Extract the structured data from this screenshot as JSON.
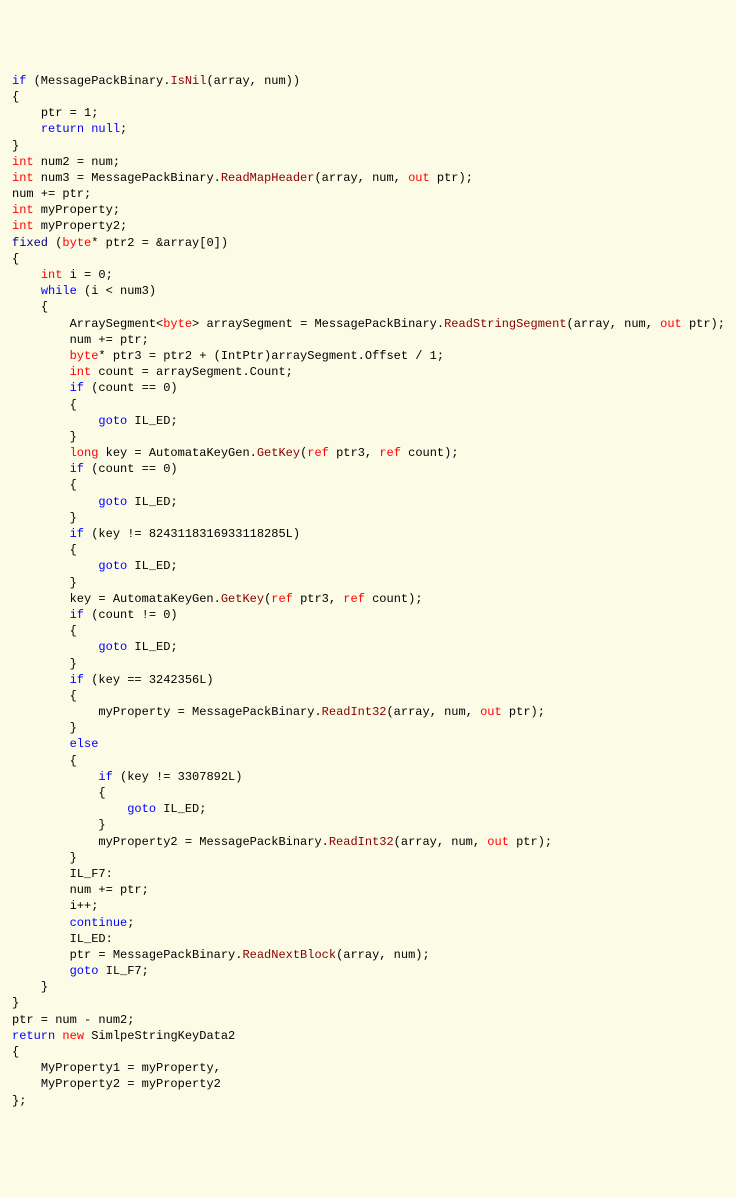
{
  "lines": [
    {
      "indent": 0,
      "tokens": [
        {
          "t": "if",
          "c": "kw"
        },
        {
          "t": " (MessagePackBinary."
        },
        {
          "t": "IsNil",
          "c": "method"
        },
        {
          "t": "(array, num))"
        }
      ]
    },
    {
      "indent": 0,
      "tokens": [
        {
          "t": "{"
        }
      ]
    },
    {
      "indent": 1,
      "tokens": [
        {
          "t": "ptr = 1;"
        }
      ]
    },
    {
      "indent": 1,
      "tokens": [
        {
          "t": "return",
          "c": "kw"
        },
        {
          "t": " "
        },
        {
          "t": "null",
          "c": "kw"
        },
        {
          "t": ";"
        }
      ]
    },
    {
      "indent": 0,
      "tokens": [
        {
          "t": "}"
        }
      ]
    },
    {
      "indent": 0,
      "tokens": [
        {
          "t": "int",
          "c": "type"
        },
        {
          "t": " num2 = num;"
        }
      ]
    },
    {
      "indent": 0,
      "tokens": [
        {
          "t": "int",
          "c": "type"
        },
        {
          "t": " num3 = MessagePackBinary."
        },
        {
          "t": "ReadMapHeader",
          "c": "method"
        },
        {
          "t": "(array, num, "
        },
        {
          "t": "out",
          "c": "type"
        },
        {
          "t": " ptr);"
        }
      ]
    },
    {
      "indent": 0,
      "tokens": [
        {
          "t": "num += ptr;"
        }
      ]
    },
    {
      "indent": 0,
      "tokens": [
        {
          "t": "int",
          "c": "type"
        },
        {
          "t": " myProperty;"
        }
      ]
    },
    {
      "indent": 0,
      "tokens": [
        {
          "t": "int",
          "c": "type"
        },
        {
          "t": " myProperty2;"
        }
      ]
    },
    {
      "indent": 0,
      "tokens": [
        {
          "t": "fixed",
          "c": "lit"
        },
        {
          "t": " ("
        },
        {
          "t": "byte",
          "c": "type"
        },
        {
          "t": "* ptr2 = &array[0])"
        }
      ]
    },
    {
      "indent": 0,
      "tokens": [
        {
          "t": "{"
        }
      ]
    },
    {
      "indent": 1,
      "tokens": [
        {
          "t": "int",
          "c": "type"
        },
        {
          "t": " i = 0;"
        }
      ]
    },
    {
      "indent": 1,
      "tokens": [
        {
          "t": "while",
          "c": "kw"
        },
        {
          "t": " (i < num3)"
        }
      ]
    },
    {
      "indent": 1,
      "tokens": [
        {
          "t": "{"
        }
      ]
    },
    {
      "indent": 2,
      "tokens": [
        {
          "t": "ArraySegment<"
        },
        {
          "t": "byte",
          "c": "type"
        },
        {
          "t": "> arraySegment = MessagePackBinary."
        },
        {
          "t": "ReadStringSegment",
          "c": "method"
        },
        {
          "t": "(array, num, "
        },
        {
          "t": "out",
          "c": "type"
        },
        {
          "t": " ptr);"
        }
      ]
    },
    {
      "indent": 2,
      "tokens": [
        {
          "t": "num += ptr;"
        }
      ]
    },
    {
      "indent": 2,
      "tokens": [
        {
          "t": "byte",
          "c": "type"
        },
        {
          "t": "* ptr3 = ptr2 + (IntPtr)arraySegment.Offset / 1;"
        }
      ]
    },
    {
      "indent": 2,
      "tokens": [
        {
          "t": "int",
          "c": "type"
        },
        {
          "t": " count = arraySegment.Count;"
        }
      ]
    },
    {
      "indent": 2,
      "tokens": [
        {
          "t": "if",
          "c": "kw"
        },
        {
          "t": " (count == 0)"
        }
      ]
    },
    {
      "indent": 2,
      "tokens": [
        {
          "t": "{"
        }
      ]
    },
    {
      "indent": 3,
      "tokens": [
        {
          "t": "goto",
          "c": "kw"
        },
        {
          "t": " IL_ED;"
        }
      ]
    },
    {
      "indent": 2,
      "tokens": [
        {
          "t": "}"
        }
      ]
    },
    {
      "indent": 2,
      "tokens": [
        {
          "t": "long",
          "c": "type"
        },
        {
          "t": " key = AutomataKeyGen."
        },
        {
          "t": "GetKey",
          "c": "method"
        },
        {
          "t": "("
        },
        {
          "t": "ref",
          "c": "type"
        },
        {
          "t": " ptr3, "
        },
        {
          "t": "ref",
          "c": "type"
        },
        {
          "t": " count);"
        }
      ]
    },
    {
      "indent": 2,
      "tokens": [
        {
          "t": "if",
          "c": "kw"
        },
        {
          "t": " (count == 0)"
        }
      ]
    },
    {
      "indent": 2,
      "tokens": [
        {
          "t": "{"
        }
      ]
    },
    {
      "indent": 3,
      "tokens": [
        {
          "t": "goto",
          "c": "kw"
        },
        {
          "t": " IL_ED;"
        }
      ]
    },
    {
      "indent": 2,
      "tokens": [
        {
          "t": "}"
        }
      ]
    },
    {
      "indent": 2,
      "tokens": [
        {
          "t": "if",
          "c": "kw"
        },
        {
          "t": " (key != 8243118316933118285L)"
        }
      ]
    },
    {
      "indent": 2,
      "tokens": [
        {
          "t": "{"
        }
      ]
    },
    {
      "indent": 3,
      "tokens": [
        {
          "t": "goto",
          "c": "kw"
        },
        {
          "t": " IL_ED;"
        }
      ]
    },
    {
      "indent": 2,
      "tokens": [
        {
          "t": "}"
        }
      ]
    },
    {
      "indent": 2,
      "tokens": [
        {
          "t": "key = AutomataKeyGen."
        },
        {
          "t": "GetKey",
          "c": "method"
        },
        {
          "t": "("
        },
        {
          "t": "ref",
          "c": "type"
        },
        {
          "t": " ptr3, "
        },
        {
          "t": "ref",
          "c": "type"
        },
        {
          "t": " count);"
        }
      ]
    },
    {
      "indent": 2,
      "tokens": [
        {
          "t": "if",
          "c": "kw"
        },
        {
          "t": " (count != 0)"
        }
      ]
    },
    {
      "indent": 2,
      "tokens": [
        {
          "t": "{"
        }
      ]
    },
    {
      "indent": 3,
      "tokens": [
        {
          "t": "goto",
          "c": "kw"
        },
        {
          "t": " IL_ED;"
        }
      ]
    },
    {
      "indent": 2,
      "tokens": [
        {
          "t": "}"
        }
      ]
    },
    {
      "indent": 2,
      "tokens": [
        {
          "t": "if",
          "c": "kw"
        },
        {
          "t": " (key == 3242356L)"
        }
      ]
    },
    {
      "indent": 2,
      "tokens": [
        {
          "t": "{"
        }
      ]
    },
    {
      "indent": 3,
      "tokens": [
        {
          "t": "myProperty = MessagePackBinary."
        },
        {
          "t": "ReadInt32",
          "c": "method"
        },
        {
          "t": "(array, num, "
        },
        {
          "t": "out",
          "c": "type"
        },
        {
          "t": " ptr);"
        }
      ]
    },
    {
      "indent": 2,
      "tokens": [
        {
          "t": "}"
        }
      ]
    },
    {
      "indent": 2,
      "tokens": [
        {
          "t": "else",
          "c": "kw"
        }
      ]
    },
    {
      "indent": 2,
      "tokens": [
        {
          "t": "{"
        }
      ]
    },
    {
      "indent": 3,
      "tokens": [
        {
          "t": "if",
          "c": "kw"
        },
        {
          "t": " (key != 3307892L)"
        }
      ]
    },
    {
      "indent": 3,
      "tokens": [
        {
          "t": "{"
        }
      ]
    },
    {
      "indent": 4,
      "tokens": [
        {
          "t": "goto",
          "c": "kw"
        },
        {
          "t": " IL_ED;"
        }
      ]
    },
    {
      "indent": 3,
      "tokens": [
        {
          "t": "}"
        }
      ]
    },
    {
      "indent": 3,
      "tokens": [
        {
          "t": "myProperty2 = MessagePackBinary."
        },
        {
          "t": "ReadInt32",
          "c": "method"
        },
        {
          "t": "(array, num, "
        },
        {
          "t": "out",
          "c": "type"
        },
        {
          "t": " ptr);"
        }
      ]
    },
    {
      "indent": 2,
      "tokens": [
        {
          "t": "}"
        }
      ]
    },
    {
      "indent": 2,
      "tokens": [
        {
          "t": "IL_F7:"
        }
      ]
    },
    {
      "indent": 2,
      "tokens": [
        {
          "t": "num += ptr;"
        }
      ]
    },
    {
      "indent": 2,
      "tokens": [
        {
          "t": "i++;"
        }
      ]
    },
    {
      "indent": 2,
      "tokens": [
        {
          "t": "continue",
          "c": "kw"
        },
        {
          "t": ";"
        }
      ]
    },
    {
      "indent": 2,
      "tokens": [
        {
          "t": "IL_ED:"
        }
      ]
    },
    {
      "indent": 2,
      "tokens": [
        {
          "t": "ptr = MessagePackBinary."
        },
        {
          "t": "ReadNextBlock",
          "c": "method"
        },
        {
          "t": "(array, num);"
        }
      ]
    },
    {
      "indent": 2,
      "tokens": [
        {
          "t": "goto",
          "c": "kw"
        },
        {
          "t": " IL_F7;"
        }
      ]
    },
    {
      "indent": 1,
      "tokens": [
        {
          "t": "}"
        }
      ]
    },
    {
      "indent": 0,
      "tokens": [
        {
          "t": "}"
        }
      ]
    },
    {
      "indent": 0,
      "tokens": [
        {
          "t": "ptr = num - num2;"
        }
      ]
    },
    {
      "indent": 0,
      "tokens": [
        {
          "t": "return",
          "c": "kw"
        },
        {
          "t": " "
        },
        {
          "t": "new",
          "c": "type"
        },
        {
          "t": " SimlpeStringKeyData2"
        }
      ]
    },
    {
      "indent": 0,
      "tokens": [
        {
          "t": "{"
        }
      ]
    },
    {
      "indent": 1,
      "tokens": [
        {
          "t": "MyProperty1 = myProperty,"
        }
      ]
    },
    {
      "indent": 1,
      "tokens": [
        {
          "t": "MyProperty2 = myProperty2"
        }
      ]
    },
    {
      "indent": 0,
      "tokens": [
        {
          "t": "};"
        }
      ]
    }
  ],
  "indentUnit": "    "
}
